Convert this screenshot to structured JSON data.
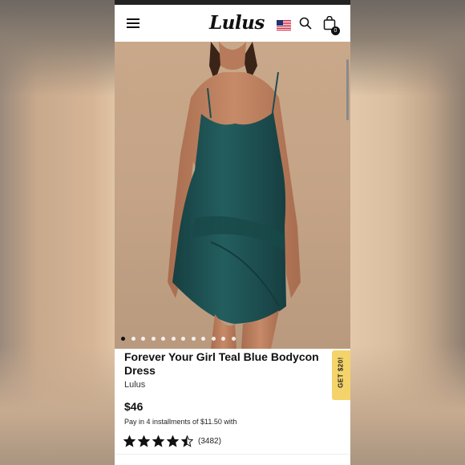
{
  "header": {
    "logo": "Lulus",
    "cart_count": "0",
    "icons": [
      "hamburger-menu-icon",
      "us-flag-icon",
      "search-icon",
      "shopping-bag-icon"
    ]
  },
  "gallery": {
    "image_count": 12,
    "active_index": 0
  },
  "product": {
    "title": "Forever Your Girl Teal Blue Bodycon Dress",
    "brand": "Lulus",
    "price": "$46",
    "installments": "Pay in 4 installments of $11.50 with",
    "rating": 4.5,
    "review_count": "(3482)"
  },
  "promo_tab": {
    "label": "GET $20!"
  },
  "colors": {
    "dress": "#1f5a5a",
    "promo_tab": "#f4d46a",
    "text": "#111111"
  }
}
